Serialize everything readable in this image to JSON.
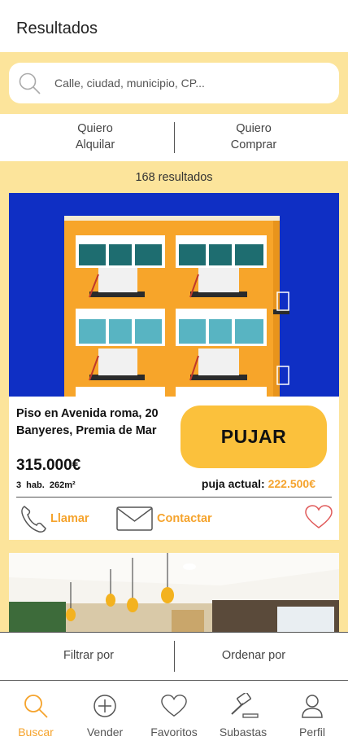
{
  "header": {
    "title": "Resultados"
  },
  "search": {
    "placeholder": "Calle, ciudad, municipio, CP..."
  },
  "mode": {
    "rent_label": "Quiero\nAlquilar",
    "buy_label": "Quiero\nComprar"
  },
  "results": {
    "count_label": "168 resultados",
    "listing": {
      "address": "Piso en Avenida roma, 20 Banyeres, Premia de Mar",
      "price": "315.000€",
      "rooms": "3 hab.",
      "area": "262m²",
      "bid_button": "PUJAR",
      "current_bid_label": "puja actual:",
      "current_bid_value": "222.500€",
      "call_label": "Llamar",
      "contact_label": "Contactar"
    }
  },
  "filters": {
    "filter_label": "Filtrar por",
    "sort_label": "Ordenar por"
  },
  "nav": {
    "items": [
      {
        "label": "Buscar",
        "icon": "search-icon",
        "active": true
      },
      {
        "label": "Vender",
        "icon": "plus-circle-icon",
        "active": false
      },
      {
        "label": "Favoritos",
        "icon": "heart-icon",
        "active": false
      },
      {
        "label": "Subastas",
        "icon": "gavel-icon",
        "active": false
      },
      {
        "label": "Perfil",
        "icon": "user-icon",
        "active": false
      }
    ]
  },
  "colors": {
    "accent": "#f5a32c",
    "band": "#fce49b",
    "button": "#fbc13c",
    "sky": "#0f2fc4"
  }
}
